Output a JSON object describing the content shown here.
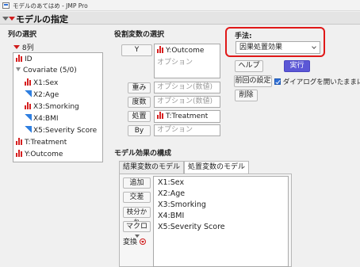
{
  "window": {
    "title": "モデルのあてはめ - JMP Pro"
  },
  "header": {
    "title": "モデルの指定"
  },
  "column_select": {
    "label": "列の選択",
    "count": "8列",
    "items": [
      {
        "label": "ID",
        "icon": "continuous-bar-icon",
        "indent": 0
      },
      {
        "label": "Covariate (5/0)",
        "icon": "group-disclosure-icon",
        "indent": 0
      },
      {
        "label": "X1:Sex",
        "icon": "continuous-bar-icon",
        "indent": 1
      },
      {
        "label": "X2:Age",
        "icon": "ordinal-ramp-icon",
        "indent": 1
      },
      {
        "label": "X3:Smorking",
        "icon": "continuous-bar-icon",
        "indent": 1
      },
      {
        "label": "X4:BMI",
        "icon": "ordinal-ramp-icon",
        "indent": 1
      },
      {
        "label": "X5:Severity Score",
        "icon": "ordinal-ramp-icon",
        "indent": 1
      },
      {
        "label": "T:Treatment",
        "icon": "continuous-bar-icon",
        "indent": 0
      },
      {
        "label": "Y:Outcome",
        "icon": "continuous-bar-icon",
        "indent": 0
      }
    ]
  },
  "roles": {
    "label": "役割変数の選択",
    "y_button": "Y",
    "y_value": "Y:Outcome",
    "y_option": "オプション",
    "weight_button": "重み",
    "weight_placeholder": "オプション(数値)",
    "freq_button": "度数",
    "freq_placeholder": "オプション(数値)",
    "treatment_button": "処置",
    "treatment_value": "T:Treatment",
    "by_button": "By",
    "by_placeholder": "オプション"
  },
  "method": {
    "label": "手法:",
    "selected": "因果処置効果",
    "highlight_color": "#e01818"
  },
  "actions": {
    "help": "ヘルプ",
    "run": "実行",
    "recall": "前回の設定",
    "keep_open": "ダイアログを開いたままにする",
    "keep_open_checked": true,
    "remove": "削除"
  },
  "effects": {
    "label": "モデル効果の構成",
    "tabs": [
      "結果変数のモデル",
      "処置変数のモデル"
    ],
    "active_tab": 1,
    "add": "追加",
    "cross": "交差",
    "nest": "枝分かれ",
    "macro": "マクロ",
    "transform": "変換",
    "items": [
      "X1:Sex",
      "X2:Age",
      "X3:Smorking",
      "X4:BMI",
      "X5:Severity Score"
    ]
  },
  "colors": {
    "accent": "#5b57d6",
    "continuous_icon": "#d62020",
    "ordinal_icon": "#2f7fe0"
  }
}
